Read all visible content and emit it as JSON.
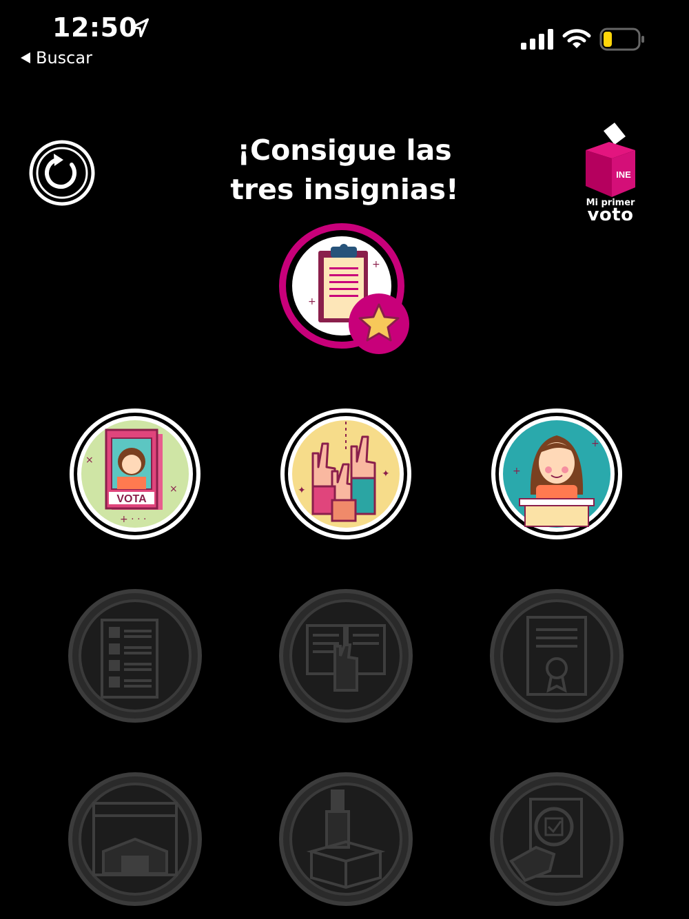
{
  "status_bar": {
    "time": "12:50",
    "back_label": "Buscar",
    "icons": [
      "location-arrow-icon",
      "signal-icon",
      "wifi-icon",
      "battery-low-icon"
    ]
  },
  "header": {
    "title_line1": "¡Consigue las",
    "title_line2": "tres insignias!",
    "reset_icon": "refresh-icon",
    "logo": {
      "brand": "INE",
      "line1": "Mi primer",
      "line2": "voto"
    }
  },
  "main_badge": {
    "icon": "clipboard-star-icon"
  },
  "earned_badges": [
    {
      "icon": "vota-poster-icon",
      "text": "VOTA"
    },
    {
      "icon": "raised-hands-icon"
    },
    {
      "icon": "speaker-woman-icon"
    }
  ],
  "locked_badges": [
    {
      "icon": "candidate-list-icon"
    },
    {
      "icon": "book-oath-icon"
    },
    {
      "icon": "certificate-icon"
    },
    {
      "icon": "building-icon"
    },
    {
      "icon": "ballot-box-icon"
    },
    {
      "icon": "document-review-icon"
    }
  ],
  "colors": {
    "background": "#000000",
    "accent": "#c8007a",
    "locked_gray": "#3a3a3a",
    "battery": "#ffd60a"
  }
}
